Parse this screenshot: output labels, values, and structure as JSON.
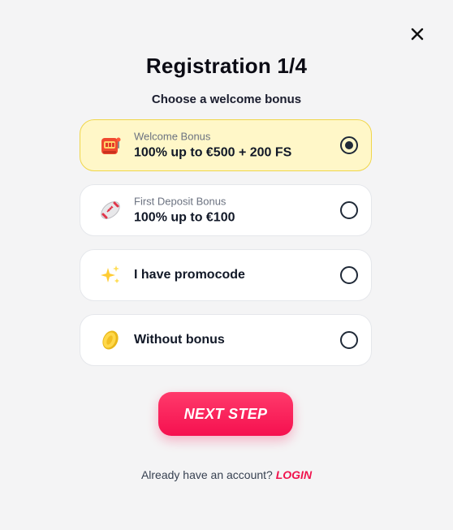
{
  "header": {
    "title": "Registration 1/4",
    "subtitle": "Choose a welcome bonus"
  },
  "options": [
    {
      "icon": "slot-machine-icon",
      "small": "Welcome Bonus",
      "main": "100% up to €500 + 200 FS",
      "selected": true
    },
    {
      "icon": "rugby-ball-icon",
      "small": "First Deposit Bonus",
      "main": "100% up to €100",
      "selected": false
    },
    {
      "icon": "sparkles-icon",
      "small": "",
      "main": "I have promocode",
      "selected": false
    },
    {
      "icon": "coin-icon",
      "small": "",
      "main": "Without bonus",
      "selected": false
    }
  ],
  "actions": {
    "next_label": "NEXT STEP"
  },
  "footer": {
    "prompt": "Already have an account?",
    "login_label": "LOGIN"
  },
  "colors": {
    "accent": "#f5104f",
    "selected_bg": "#fff7c8",
    "selected_border": "#f0d64a"
  }
}
